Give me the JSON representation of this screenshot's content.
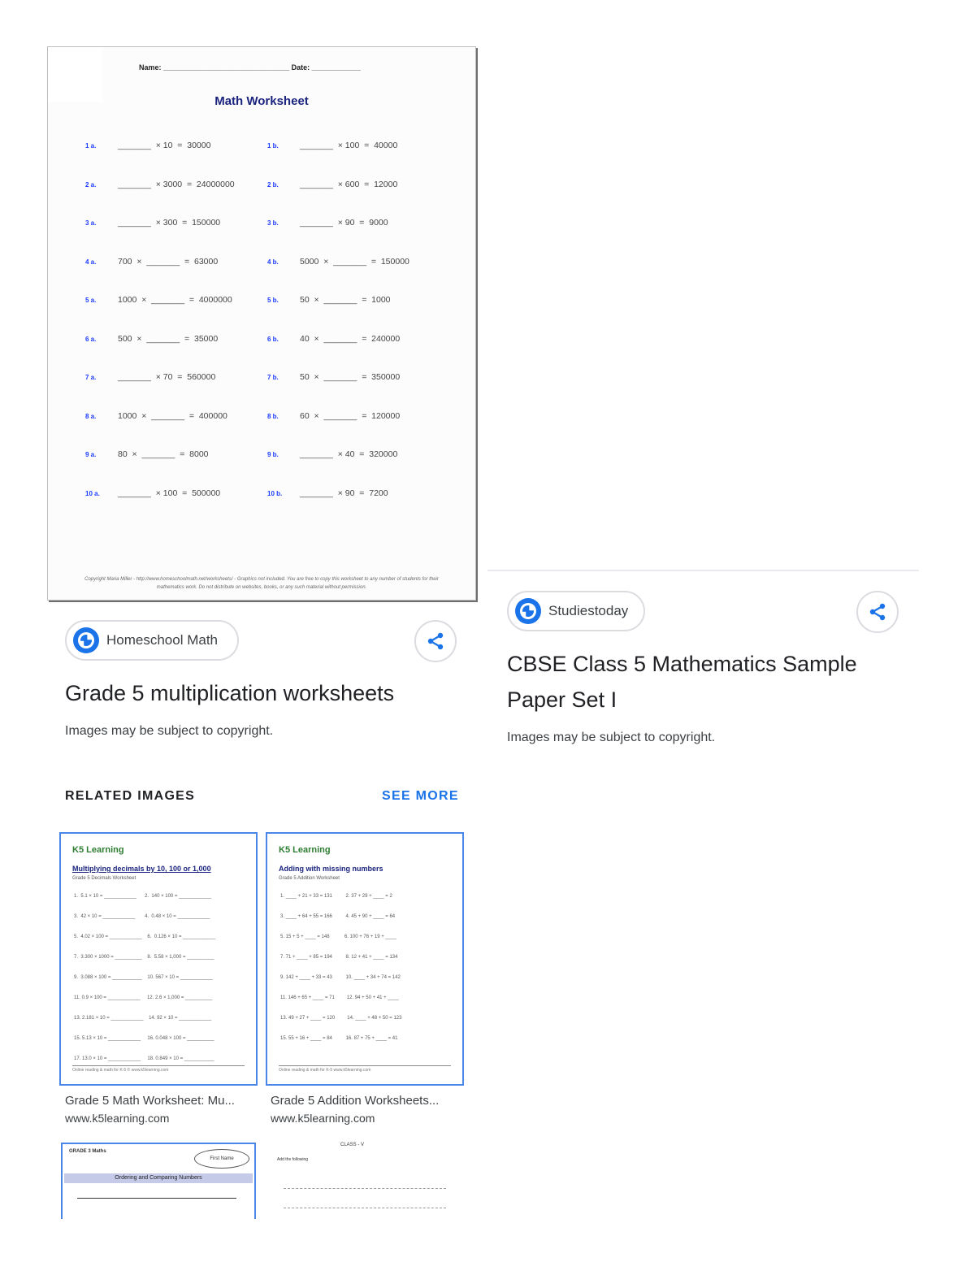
{
  "worksheet": {
    "name_line": "Name: _______________________________  Date: ____________",
    "title": "Math Worksheet",
    "problems": [
      {
        "a_num": "1 a.",
        "a": "_______  × 10  =  30000",
        "b_num": "1 b.",
        "b": "_______  × 100  =  40000"
      },
      {
        "a_num": "2 a.",
        "a": "_______  × 3000  =  24000000",
        "b_num": "2 b.",
        "b": "_______  × 600  =  12000"
      },
      {
        "a_num": "3 a.",
        "a": "_______  × 300  =  150000",
        "b_num": "3 b.",
        "b": "_______  × 90  =  9000"
      },
      {
        "a_num": "4 a.",
        "a": "700  ×  _______  =  63000",
        "b_num": "4 b.",
        "b": "5000  ×  _______  =  150000"
      },
      {
        "a_num": "5 a.",
        "a": "1000  ×  _______  =  4000000",
        "b_num": "5 b.",
        "b": "50  ×  _______  =  1000"
      },
      {
        "a_num": "6 a.",
        "a": "500  ×  _______  =  35000",
        "b_num": "6 b.",
        "b": "40  ×  _______  =  240000"
      },
      {
        "a_num": "7 a.",
        "a": "_______  × 70  =  560000",
        "b_num": "7 b.",
        "b": "50  ×  _______  =  350000"
      },
      {
        "a_num": "8 a.",
        "a": "1000  ×  _______  =  400000",
        "b_num": "8 b.",
        "b": "60  ×  _______  =  120000"
      },
      {
        "a_num": "9 a.",
        "a": "80  ×  _______  =  8000",
        "b_num": "9 b.",
        "b": "_______  × 40  =  320000"
      },
      {
        "a_num": "10 a.",
        "a": "_______  × 100  =  500000",
        "b_num": "10 b.",
        "b": "_______  × 90  =  7200"
      }
    ],
    "footer": "Copyright Maria Miller - http://www.homeschoolmath.net/worksheets/ - Graphics not included. You are free to copy this worksheet to any number of students for their mathematics work. Do not distribute on websites, books, or any such material without permission."
  },
  "left_result": {
    "source": "Homeschool Math",
    "title": "Grade 5 multiplication worksheets",
    "note": "Images may be subject to copyright."
  },
  "right_result": {
    "source": "Studiestoday",
    "title_line1": "CBSE Class 5 Mathematics Sample",
    "title_line2": "Paper Set I",
    "note": "Images may be subject to copyright."
  },
  "related": {
    "heading": "RELATED IMAGES",
    "see_more": "SEE MORE",
    "items": [
      {
        "caption": "Grade 5 Math Worksheet: Mu...",
        "source": "www.k5learning.com",
        "logo": "K5 Learning",
        "title": "Multiplying decimals by 10, 100 or 1,000",
        "subtitle": "Grade 5 Decimals Worksheet",
        "rows": [
          "1.  5.1 × 10 = ____________      2.  140 × 100 = ____________",
          "3.  42 × 10 = ____________       4.  0.48 × 10 = ____________",
          "5.  4.02 × 100 = ____________    6.  0.126 × 10 = ____________",
          "7.  3.300 × 1000 = __________    8.  5.58 × 1,000 = __________",
          "9.  3.088 × 100 = ___________    10. 567 × 10 = ____________",
          "11. 0.9 × 100 = ____________     12. 2.6 × 1,000 = __________",
          "13. 2.181 × 10 = ____________    14. 92 × 10 = ____________",
          "15. 5.13 × 10 = ____________     16. 0.048 × 100 = __________",
          "17. 13.0 × 10 = ____________     18. 0.849 × 10 = ___________"
        ],
        "footer": "Online reading & math for K-5             © www.k5learning.com"
      },
      {
        "caption": "Grade 5 Addition Worksheets...",
        "source": "www.k5learning.com",
        "logo": "K5 Learning",
        "title": "Adding with missing numbers",
        "subtitle": "Grade 5 Addition Worksheet",
        "rows": [
          "1. ____ + 21 + 33 = 131          2. 37 + 29 + ____ = 2",
          "3. ____ + 64 + 55 = 166          4. 45 + 90 + ____ = 64",
          "5. 15 + 5 + ____ = 148           6. 100 + 76 + 19 + ____",
          "7. 71 + ____ + 85 = 194          8. 12 + 41 + ____ = 134",
          "9. 142 + ____ + 33 = 43          10. ____ + 34 + 74 = 142",
          "11. 146 + 65 + ____ = 71         12. 94 + 50 + 41 + ____",
          "13. 49 + 27 + ____ = 120         14. ____ + 48 + 50 = 123",
          "15. 55 + 16 + ____ = 84          16. 87 + 75 + ____ = 41"
        ],
        "footer": "Online reading & math for K-5             www.k5learning.com"
      }
    ],
    "partial": [
      {
        "title": "Ordering and Comparing Numbers",
        "badge": "First Name",
        "header": "GRADE 3  Maths"
      },
      {
        "title": "CLASS - V",
        "header": "Add the following"
      }
    ]
  }
}
